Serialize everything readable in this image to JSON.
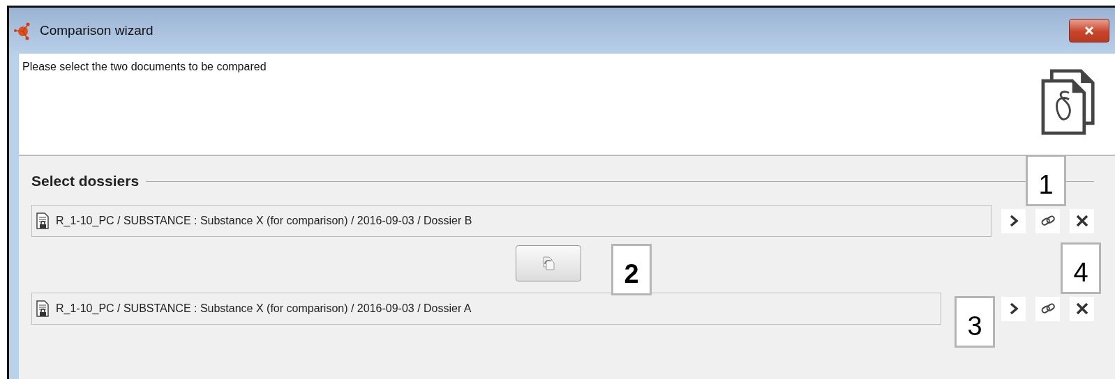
{
  "window": {
    "title": "Comparison wizard"
  },
  "instruction": "Please select the two documents to be compared",
  "section": {
    "title": "Select dossiers"
  },
  "dossiers": [
    {
      "text": "R_1-10_PC / SUBSTANCE : Substance X (for comparison) /  2016-09-03 / Dossier B"
    },
    {
      "text": "R_1-10_PC / SUBSTANCE : Substance X (for comparison) /  2016-09-03 / Dossier A"
    }
  ],
  "callouts": [
    {
      "text": "1",
      "bold": false
    },
    {
      "text": "2",
      "bold": true
    },
    {
      "text": "3",
      "bold": false
    },
    {
      "text": "4",
      "bold": false
    }
  ]
}
